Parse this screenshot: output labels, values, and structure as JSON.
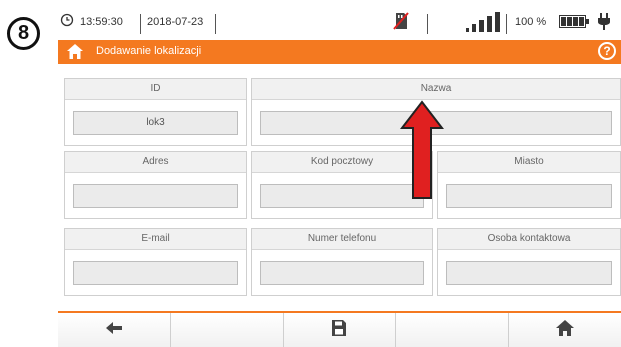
{
  "step_badge": "8",
  "status": {
    "time": "13:59:30",
    "date": "2018-07-23",
    "battery_percent": "100 %",
    "signal_bars": 4
  },
  "header": {
    "title": "Dodawanie lokalizacji",
    "help": "?"
  },
  "form": {
    "id": {
      "label": "ID",
      "value": "lok3"
    },
    "nazwa": {
      "label": "Nazwa",
      "value": ""
    },
    "adres": {
      "label": "Adres",
      "value": ""
    },
    "kod": {
      "label": "Kod pocztowy",
      "value": ""
    },
    "miasto": {
      "label": "Miasto",
      "value": ""
    },
    "email": {
      "label": "E-mail",
      "value": ""
    },
    "telefon": {
      "label": "Numer telefonu",
      "value": ""
    },
    "osoba": {
      "label": "Osoba kontaktowa",
      "value": ""
    }
  },
  "toolbar": {
    "buttons": [
      "back-arrow-icon",
      "",
      "save-icon",
      "",
      "home-icon"
    ]
  },
  "colors": {
    "accent": "#f47920",
    "annotation_arrow": "#e02020"
  }
}
